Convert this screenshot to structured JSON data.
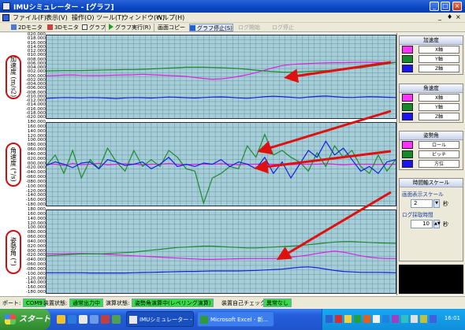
{
  "window": {
    "title": "IMUシミュレーター - [グラフ]",
    "controls": {
      "minimize": "_",
      "maximize": "□",
      "close": "×"
    }
  },
  "menu": {
    "items": [
      "ファイル(F)",
      "表示(V)",
      "操作(O)",
      "ツール(T)",
      "ウィンドウ(W)",
      "ヘルプ(H)"
    ],
    "child_controls": [
      "_",
      "♦",
      "×"
    ]
  },
  "toolbar": {
    "btn_2d": "2Dモニタ",
    "btn_3d": "3Dモニタ",
    "btn_graph": "グラフ",
    "btn_run": "グラフ実行(R)",
    "btn_copy": "画面コピー",
    "btn_stop": "グラフ停止(S)",
    "btn_log_start": "ログ開始",
    "btn_log_stop": "ログ停止"
  },
  "plots": [
    {
      "label": "加速度 (m/s2)",
      "ticks": [
        "020.000",
        "018.000",
        "016.000",
        "014.000",
        "012.000",
        "010.000",
        "008.000",
        "006.000",
        "004.000",
        "002.000",
        "000.000",
        "-002.000",
        "-004.000",
        "-006.000",
        "-008.000",
        "-010.000",
        "-012.000",
        "-014.000",
        "-016.000",
        "-018.000",
        "-020.000"
      ],
      "ylim": [
        -20,
        20
      ]
    },
    {
      "label": "角速度 (°/s)",
      "ticks": [
        "180.000",
        "160.000",
        "140.000",
        "120.000",
        "100.000",
        "080.000",
        "060.000",
        "040.000",
        "020.000",
        "000.000",
        "-020.000",
        "-040.000",
        "-060.000",
        "-080.000",
        "-100.000",
        "-120.000",
        "-140.000",
        "-160.000",
        "-180.000"
      ],
      "ylim": [
        -180,
        180
      ]
    },
    {
      "label": "姿勢角 (°)",
      "ticks": [
        "180.000",
        "160.000",
        "140.000",
        "120.000",
        "100.000",
        "080.000",
        "060.000",
        "040.000",
        "020.000",
        "000.000",
        "-020.000",
        "-040.000",
        "-060.000",
        "-080.000",
        "-100.000",
        "-120.000",
        "-140.000",
        "-160.000",
        "-180.000"
      ],
      "ylim": [
        -180,
        180
      ]
    }
  ],
  "chart_data": [
    {
      "type": "line",
      "ylabel": "加速度 (m/s2)",
      "ylim": [
        -20,
        20
      ],
      "series": [
        {
          "name": "X軸",
          "color": "#e020e0",
          "values": [
            0.5,
            0.6,
            0.8,
            0.9,
            0.7,
            0.6,
            0.6,
            0.7,
            0.8,
            0.9,
            1.0,
            1.2,
            1.0,
            0.8,
            0.6,
            0.4,
            0.2,
            -0.3,
            -0.8,
            -1.2,
            -1.0,
            -0.5,
            0.2,
            1.0,
            2.0,
            3.2,
            4.4,
            5.4,
            6.0,
            6.2,
            6.4,
            6.6,
            6.7,
            6.8,
            6.8,
            6.9,
            7.0,
            7.0,
            6.9,
            6.9,
            7.0
          ]
        },
        {
          "name": "Y軸",
          "color": "#1e8a2e",
          "values": [
            2.8,
            2.9,
            3.0,
            3.0,
            3.0,
            3.1,
            3.2,
            3.3,
            3.4,
            3.5,
            3.5,
            3.6,
            3.8,
            4.0,
            4.2,
            4.4,
            4.6,
            4.6,
            4.6,
            4.5,
            4.4,
            4.2,
            4.0,
            3.6,
            3.2,
            2.8,
            2.5,
            2.3,
            2.2,
            2.4,
            2.6,
            2.8,
            3.0,
            3.2,
            3.6,
            4.0,
            4.4,
            5.0,
            5.6,
            6.2,
            7.0
          ]
        },
        {
          "name": "Z軸",
          "color": "#1020e0",
          "values": [
            -10.4,
            -10.2,
            -10.0,
            -10.1,
            -10.2,
            -10.0,
            -10.1,
            -10.3,
            -10.5,
            -10.2,
            -10.0,
            -10.1,
            -10.3,
            -10.0,
            -9.8,
            -9.9,
            -10.1,
            -10.3,
            -10.0,
            -9.8,
            -9.7,
            -9.9,
            -10.2,
            -10.4,
            -10.0,
            -9.6,
            -9.4,
            -9.6,
            -9.9,
            -10.2,
            -9.8,
            -9.5,
            -9.3,
            -9.6,
            -9.9,
            -10.0,
            -9.8,
            -9.6,
            -9.7,
            -9.9,
            -10.0
          ]
        }
      ]
    },
    {
      "type": "line",
      "ylabel": "角速度 (°/s)",
      "ylim": [
        -180,
        180
      ],
      "series": [
        {
          "name": "X軸",
          "color": "#e020e0",
          "values": [
            0,
            0,
            -5,
            3,
            -2,
            0,
            4,
            -3,
            0,
            2,
            0,
            -2,
            0,
            0,
            3,
            0,
            -2,
            0,
            0,
            0,
            2,
            0,
            -2,
            0,
            0,
            1,
            0,
            0,
            -2,
            0,
            0,
            0,
            2,
            0,
            -3,
            0,
            0,
            0,
            -1,
            0,
            0
          ]
        },
        {
          "name": "Y軸",
          "color": "#1e8a2e",
          "values": [
            -5,
            40,
            -40,
            60,
            -60,
            20,
            -20,
            70,
            10,
            -30,
            60,
            -10,
            20,
            -10,
            60,
            30,
            -20,
            -30,
            -170,
            -60,
            -40,
            -10,
            -20,
            80,
            30,
            130,
            40,
            60,
            30,
            10,
            -30,
            50,
            -10,
            80,
            30,
            60,
            -10,
            -40,
            40,
            -30,
            20
          ]
        },
        {
          "name": "Z軸",
          "color": "#1020e0",
          "values": [
            -5,
            10,
            0,
            -15,
            5,
            10,
            -20,
            20,
            10,
            -5,
            0,
            10,
            -20,
            0,
            30,
            -10,
            0,
            -10,
            5,
            0,
            20,
            -10,
            10,
            0,
            -20,
            30,
            -40,
            10,
            -60,
            0,
            60,
            30,
            100,
            40,
            70,
            20,
            -30,
            -10,
            -40,
            10,
            20
          ]
        }
      ]
    },
    {
      "type": "line",
      "ylabel": "姿勢角 (°)",
      "ylim": [
        -180,
        180
      ],
      "series": [
        {
          "name": "ロール",
          "color": "#e020e0",
          "values": [
            -10,
            -10,
            -9,
            -8,
            -8,
            -9,
            -10,
            -12,
            -14,
            -16,
            -18,
            -20,
            -22,
            -24,
            -26,
            -28,
            -30,
            -32,
            -34,
            -34,
            -33,
            -32,
            -31,
            -30,
            -30,
            -30,
            -30,
            -28,
            -24,
            -20,
            -15,
            -8,
            -2,
            2,
            -2,
            -10,
            -18,
            -24,
            -28,
            -30,
            -30
          ]
        },
        {
          "name": "ピッチ",
          "color": "#1e8a2e",
          "values": [
            -18,
            -16,
            -14,
            -12,
            -10,
            -10,
            -10,
            -8,
            -6,
            -4,
            -2,
            2,
            6,
            10,
            14,
            18,
            20,
            22,
            24,
            24,
            22,
            20,
            18,
            16,
            16,
            18,
            20,
            22,
            24,
            26,
            30,
            34,
            38,
            42,
            44,
            44,
            42,
            40,
            38,
            37,
            36
          ]
        },
        {
          "name": "方位",
          "color": "#1020e0",
          "values": [
            -92,
            -92,
            -92,
            -92,
            -92,
            -93,
            -93,
            -93,
            -93,
            -93,
            -92,
            -91,
            -90,
            -89,
            -88,
            -87,
            -86,
            -86,
            -85,
            -84,
            -84,
            -84,
            -84,
            -83,
            -82,
            -80,
            -78,
            -76,
            -72,
            -68,
            -66,
            -70,
            -76,
            -82,
            -86,
            -88,
            -90,
            -90,
            -90,
            -91,
            -92
          ]
        }
      ]
    }
  ],
  "right_panel": {
    "accel": {
      "title": "加速度",
      "items": [
        {
          "name": "X軸",
          "color": "#ff33ff"
        },
        {
          "name": "Y軸",
          "color": "#148a2a"
        },
        {
          "name": "Z軸",
          "color": "#1a14f0"
        }
      ]
    },
    "gyro": {
      "title": "角速度",
      "items": [
        {
          "name": "X軸",
          "color": "#ff33ff"
        },
        {
          "name": "Y軸",
          "color": "#148a2a"
        },
        {
          "name": "Z軸",
          "color": "#1a14f0"
        }
      ]
    },
    "attitude": {
      "title": "姿勢角",
      "items": [
        {
          "name": "ロール",
          "color": "#ff33ff"
        },
        {
          "name": "ピッチ",
          "color": "#148a2a"
        },
        {
          "name": "方位",
          "color": "#1a14f0"
        }
      ]
    },
    "timescale": {
      "title": "時間軸スケール",
      "display_label": "画面表示スケール",
      "display_value": "2",
      "display_unit": "秒",
      "log_label": "ログ採取時間",
      "log_value": "10",
      "log_unit": "秒"
    }
  },
  "statusbar": {
    "port_label": "ポート:",
    "port_value": "COM9",
    "device_label": "装置状態:",
    "device_value": "通常出力中",
    "calc_label": "演算状態:",
    "calc_value": "姿勢角演算中(レベリング演算)",
    "selfcheck_label": "装置自己チェック:",
    "selfcheck_value": "異常なし"
  },
  "taskbar": {
    "start": "スタート",
    "tasks": [
      "IMUシミュレーター - [グラ...",
      "Microsoft Excel - 新..."
    ],
    "clock": "16:01"
  },
  "colors": {
    "plot_bg": "#a6ced8",
    "grid": "#5a8a98",
    "annotation": "#e01010",
    "series_x": "#e020e0",
    "series_y": "#1e8a2e",
    "series_z": "#1020e0"
  }
}
